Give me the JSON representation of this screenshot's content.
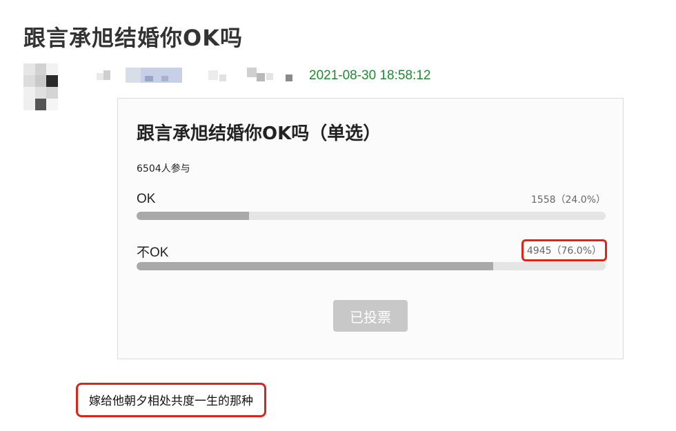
{
  "post": {
    "title": "跟言承旭结婚你OK吗",
    "timestamp": "2021-08-30 18:58:12"
  },
  "poll": {
    "title": "跟言承旭结婚你OK吗（单选）",
    "participants": "6504人参与",
    "options": [
      {
        "label": "OK",
        "count": "1558（24.0%）",
        "fraction": 0.24
      },
      {
        "label": "不OK",
        "count": "4945（76.0%）",
        "fraction": 0.76
      }
    ],
    "button_label": "已投票"
  },
  "comment": {
    "text": "嫁给他朝夕相处共度一生的那种"
  },
  "colors": {
    "timestamp": "#1e8a2e",
    "highlight": "#d8261c",
    "bar_fill": "#a9a9a9",
    "bar_track": "#e5e5e5",
    "button_bg": "#c8c8c8"
  }
}
